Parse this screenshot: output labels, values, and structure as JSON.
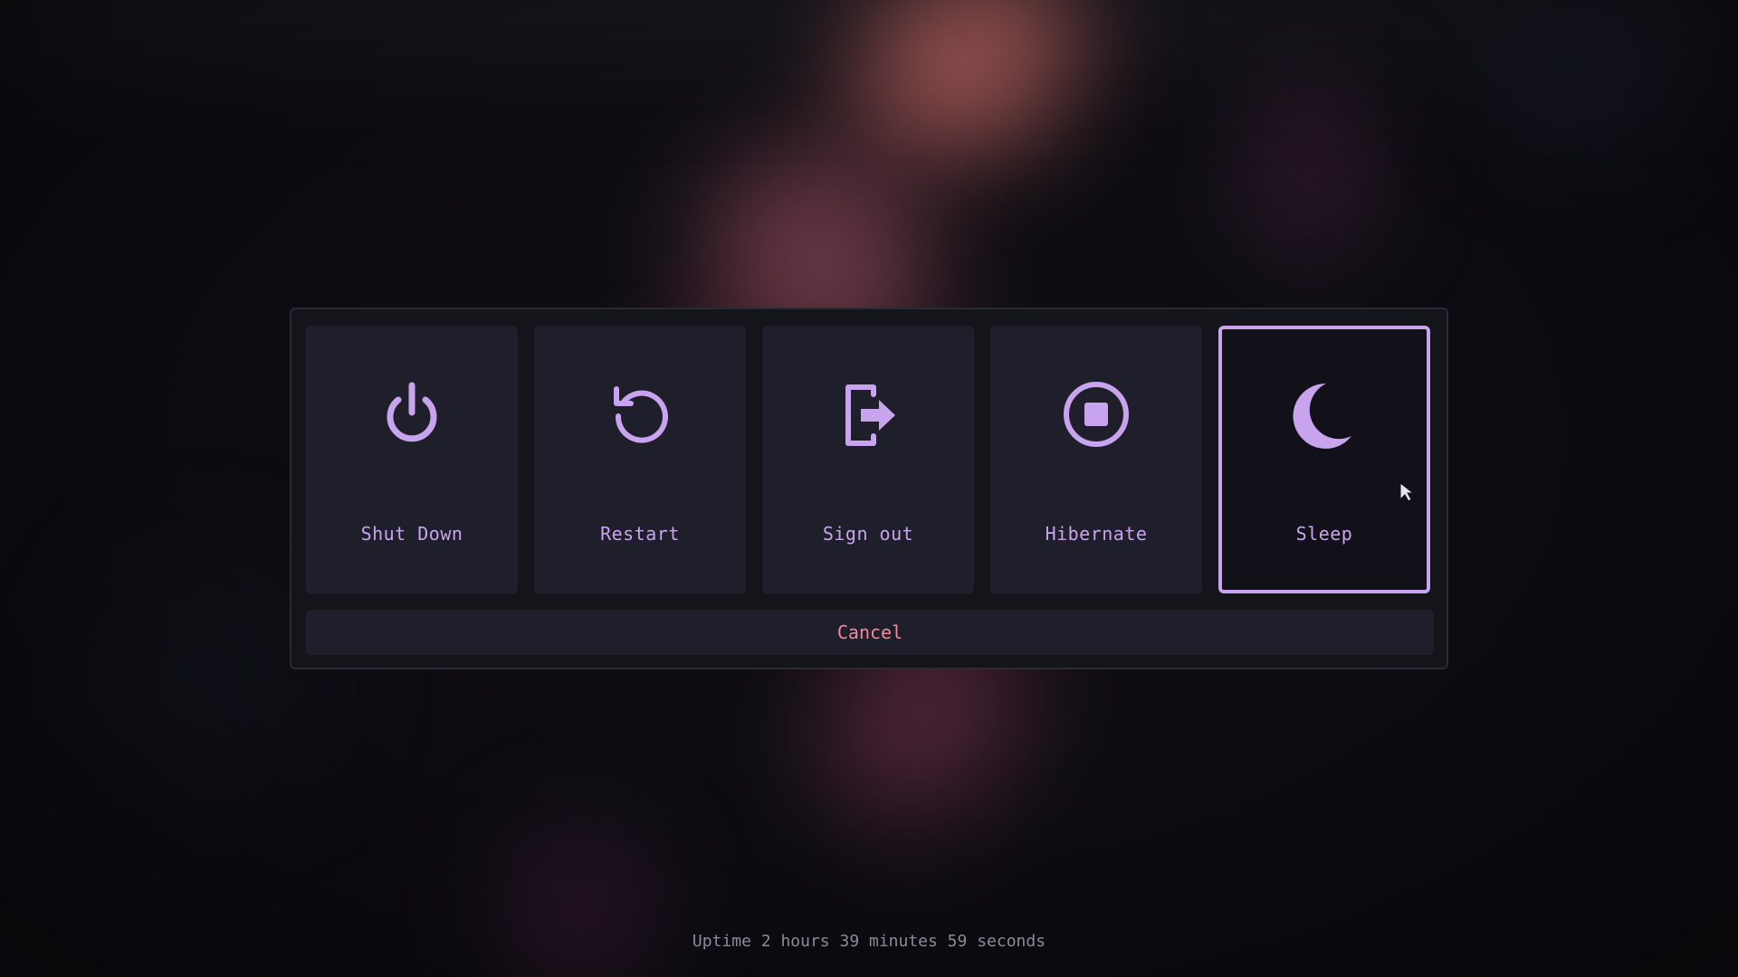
{
  "dialog": {
    "options": [
      {
        "label": "Shut Down",
        "icon": "power-icon"
      },
      {
        "label": "Restart",
        "icon": "restart-icon"
      },
      {
        "label": "Sign out",
        "icon": "sign-out-icon"
      },
      {
        "label": "Hibernate",
        "icon": "hibernate-icon"
      },
      {
        "label": "Sleep",
        "icon": "moon-icon",
        "selected": true
      }
    ],
    "cancel_label": "Cancel"
  },
  "status": {
    "uptime": "Uptime 2 hours 39 minutes 59 seconds"
  },
  "colors": {
    "accent": "#c9a4ee",
    "cancel": "#f08aa0",
    "tile": "#1f1e2b",
    "panel": "#14141b"
  }
}
